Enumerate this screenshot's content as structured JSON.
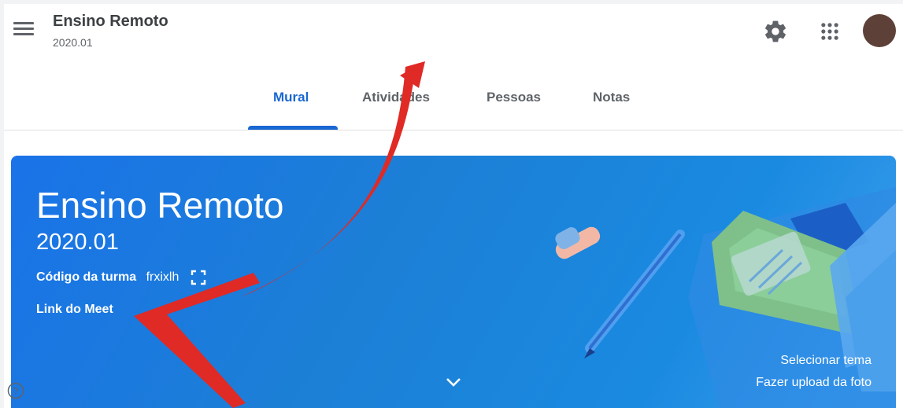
{
  "header": {
    "course_title": "Ensino Remoto",
    "course_section": "2020.01",
    "menu_icon": "hamburger-menu-icon",
    "settings_icon": "gear-icon",
    "apps_icon": "apps-grid-icon",
    "avatar_color": "#5d4037"
  },
  "tabs": [
    {
      "label": "Mural",
      "active": true
    },
    {
      "label": "Atividades",
      "active": false
    },
    {
      "label": "Pessoas",
      "active": false
    },
    {
      "label": "Notas",
      "active": false
    }
  ],
  "banner": {
    "title": "Ensino Remoto",
    "subtitle": "2020.01",
    "code_label": "Código da turma",
    "code_value": "frxixlh",
    "meet_link_label": "Link do Meet",
    "select_theme": "Selecionar tema",
    "upload_photo": "Fazer upload da foto"
  },
  "colors": {
    "accent": "#1967d2",
    "banner": "#1a73e8",
    "annotation": "#e02a25"
  }
}
